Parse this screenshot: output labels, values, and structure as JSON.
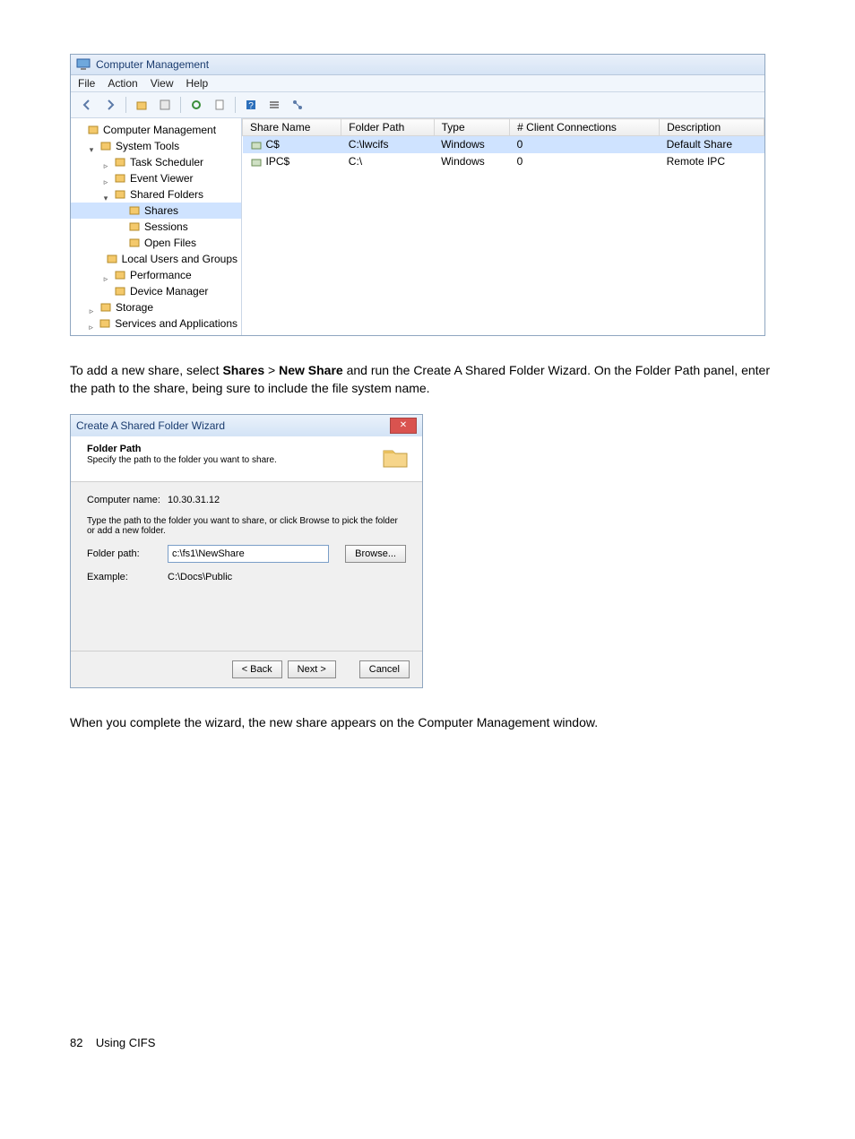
{
  "cm": {
    "title": "Computer Management",
    "menus": [
      "File",
      "Action",
      "View",
      "Help"
    ],
    "toolbar_icons": [
      "back-icon",
      "forward-icon",
      "up-icon",
      "properties-icon",
      "refresh-icon",
      "export-icon",
      "help-icon",
      "list-icon",
      "share-icon"
    ],
    "tree": [
      {
        "lvl": 0,
        "exp": "",
        "icon": "computer-icon",
        "label": "Computer Management",
        "sel": false
      },
      {
        "lvl": 1,
        "exp": "▾",
        "icon": "wrench-icon",
        "label": "System Tools",
        "sel": false
      },
      {
        "lvl": 2,
        "exp": "▹",
        "icon": "clock-icon",
        "label": "Task Scheduler",
        "sel": false
      },
      {
        "lvl": 2,
        "exp": "▹",
        "icon": "event-icon",
        "label": "Event Viewer",
        "sel": false
      },
      {
        "lvl": 2,
        "exp": "▾",
        "icon": "folder-shared-icon",
        "label": "Shared Folders",
        "sel": false
      },
      {
        "lvl": 3,
        "exp": "",
        "icon": "share-item-icon",
        "label": "Shares",
        "sel": true
      },
      {
        "lvl": 3,
        "exp": "",
        "icon": "share-item-icon",
        "label": "Sessions",
        "sel": false
      },
      {
        "lvl": 3,
        "exp": "",
        "icon": "share-item-icon",
        "label": "Open Files",
        "sel": false
      },
      {
        "lvl": 2,
        "exp": "",
        "icon": "users-icon",
        "label": "Local Users and Groups",
        "sel": false
      },
      {
        "lvl": 2,
        "exp": "▹",
        "icon": "perf-icon",
        "label": "Performance",
        "sel": false
      },
      {
        "lvl": 2,
        "exp": "",
        "icon": "device-icon",
        "label": "Device Manager",
        "sel": false
      },
      {
        "lvl": 1,
        "exp": "▹",
        "icon": "storage-icon",
        "label": "Storage",
        "sel": false
      },
      {
        "lvl": 1,
        "exp": "▹",
        "icon": "services-icon",
        "label": "Services and Applications",
        "sel": false
      }
    ],
    "columns": [
      "Share Name",
      "Folder Path",
      "Type",
      "# Client Connections",
      "Description"
    ],
    "rows": [
      {
        "sel": true,
        "cells": [
          "C$",
          "C:\\lwcifs",
          "Windows",
          "0",
          "Default Share"
        ]
      },
      {
        "sel": false,
        "cells": [
          "IPC$",
          "C:\\",
          "Windows",
          "0",
          "Remote IPC"
        ]
      }
    ]
  },
  "para1_a": "To add a new share, select ",
  "para1_b": "Shares",
  "para1_c": " > ",
  "para1_d": "New Share",
  "para1_e": " and run the Create A Shared Folder Wizard. On the Folder Path panel, enter the path to the share, being sure to include the file system name.",
  "wizard": {
    "title": "Create A Shared Folder Wizard",
    "header_title": "Folder Path",
    "header_sub": "Specify the path to the folder you want to share.",
    "computer_name_label": "Computer name:",
    "computer_name_value": "10.30.31.12",
    "instruction": "Type the path to the folder you want to share, or click Browse to pick the folder or add a new folder.",
    "folder_path_label": "Folder path:",
    "folder_path_value": "c:\\fs1\\NewShare",
    "browse_label": "Browse...",
    "example_label": "Example:",
    "example_value": "C:\\Docs\\Public",
    "back_label": "< Back",
    "next_label": "Next >",
    "cancel_label": "Cancel"
  },
  "para2": "When you complete the wizard, the new share appears on the Computer Management window.",
  "footer_page": "82",
  "footer_text": "Using CIFS"
}
